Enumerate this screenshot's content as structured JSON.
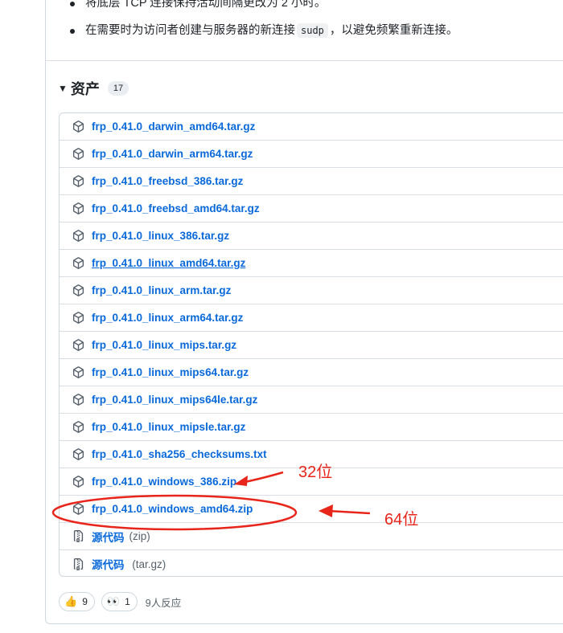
{
  "release_notes": [
    "将底层 TCP 连接保持活动间隔更改为 2 小时。",
    {
      "before": "在需要时为访问者创建与服务器的新连接",
      "code": "sudp",
      "after": "，以避免频繁重新连接。"
    }
  ],
  "assets": {
    "title": "资产",
    "count": "17",
    "files": [
      "frp_0.41.0_darwin_amd64.tar.gz",
      "frp_0.41.0_darwin_arm64.tar.gz",
      "frp_0.41.0_freebsd_386.tar.gz",
      "frp_0.41.0_freebsd_amd64.tar.gz",
      "frp_0.41.0_linux_386.tar.gz",
      "frp_0.41.0_linux_amd64.tar.gz",
      "frp_0.41.0_linux_arm.tar.gz",
      "frp_0.41.0_linux_arm64.tar.gz",
      "frp_0.41.0_linux_mips.tar.gz",
      "frp_0.41.0_linux_mips64.tar.gz",
      "frp_0.41.0_linux_mips64le.tar.gz",
      "frp_0.41.0_linux_mipsle.tar.gz",
      "frp_0.41.0_sha256_checksums.txt",
      "frp_0.41.0_windows_386.zip",
      "frp_0.41.0_windows_amd64.zip"
    ],
    "source_zip": {
      "label": "源代码",
      "suffix": "(zip)"
    },
    "source_targz": {
      "label": "源代码",
      "suffix": " (tar.gz)"
    }
  },
  "reactions": {
    "thumbs_up": {
      "icon": "thumbs-up-icon",
      "count": "9"
    },
    "eyes": {
      "icon": "eyes-icon",
      "count": "1"
    },
    "summary": "9人反应"
  },
  "annotations": {
    "label_32": "32位",
    "label_64": "64位",
    "color": "#e8251a"
  },
  "colors": {
    "link": "#0969da",
    "border": "#d0d7de",
    "muted": "#57606a"
  }
}
